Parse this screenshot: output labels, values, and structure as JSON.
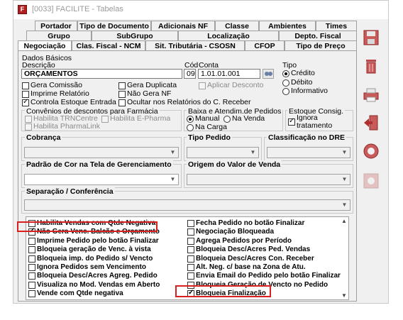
{
  "window": {
    "title": "[0033] FACILITE - Tabelas"
  },
  "tabs": {
    "row1": [
      "Portador",
      "Tipo de Documento",
      "Adicionais NF",
      "Classe",
      "Ambientes",
      "Times"
    ],
    "row2": [
      "Grupo",
      "SubGrupo",
      "Localização",
      "Depto. Fiscal"
    ],
    "row3": [
      "Negociação",
      "Clas. Fiscal - NCM",
      "Sit. Tributária - CSOSN",
      "CFOP",
      "Tipo de Preço"
    ]
  },
  "dados": {
    "section_title": "Dados Básicos",
    "descricao_label": "Descrição",
    "descricao_value": "ORÇAMENTOS",
    "cod_label": "Cód",
    "cod_value": "09",
    "conta_label": "Conta",
    "conta_value": "1.01.01.001",
    "tipo_label": "Tipo",
    "tipo_options": [
      "Crédito",
      "Débito",
      "Informativo"
    ],
    "tipo_selected": "Crédito",
    "checks": {
      "gera_comissao": "Gera Comissão",
      "imprime_relatorio": "Imprime Relatório",
      "controla_estoque": "Controla Estoque Entrada",
      "gera_duplicata": "Gera Duplicata",
      "nao_gera_nf": "Não Gera NF",
      "ocultar_relatorios": "Ocultar nos Relatórios do C. Receber",
      "aplicar_desconto": "Aplicar Desconto"
    }
  },
  "convenios": {
    "title": "Convênios de descontos para Farmácia",
    "trn": "Habilita TRNCentre",
    "epharma": "Habilita E-Pharma",
    "pharmalink": "Habilita PharmaLink"
  },
  "baixa": {
    "title": "Baixa e Atendim.de Pedidos",
    "options": [
      "Manual",
      "Na Venda",
      "Na Carga"
    ],
    "selected": "Manual"
  },
  "estoque": {
    "title": "Estoque Consig.",
    "ignora": "Ignora tratamento"
  },
  "combos": {
    "cobranca": "Cobrança",
    "tipo_pedido": "Tipo Pedido",
    "classificacao_dre": "Classificação no DRE",
    "padrao_cor": "Padrão de Cor na Tela de Gerenciamento",
    "origem_valor": "Origem do Valor de Venda",
    "separacao": "Separação / Conferência"
  },
  "options_left": [
    {
      "label": "Habilita Vendas com Qtde Negativa",
      "checked": false
    },
    {
      "label": "Não Gera Venc. Balcão e Orçamento",
      "checked": true
    },
    {
      "label": "Imprime Pedido pelo botão Finalizar",
      "checked": false
    },
    {
      "label": "Bloqueia geração de Venc. à vista",
      "checked": false
    },
    {
      "label": "Bloqueia imp. do Pedido s/ Vencto",
      "checked": false
    },
    {
      "label": "Ignora Pedidos sem Vencimento",
      "checked": false
    },
    {
      "label": "Bloqueia Desc/Acres Agreg. Pedido",
      "checked": false
    },
    {
      "label": "Visualiza no Mod. Vendas em Aberto",
      "checked": false
    },
    {
      "label": "Vende com Qtde negativa",
      "checked": false
    }
  ],
  "options_right": [
    {
      "label": "Fecha Pedido no botão Finalizar",
      "checked": false
    },
    {
      "label": "Negociação Bloqueada",
      "checked": false
    },
    {
      "label": "Agrega Pedidos por Período",
      "checked": false
    },
    {
      "label": "Bloqueia Desc/Acres Ped. Vendas",
      "checked": false
    },
    {
      "label": "Bloqueia Desc/Acres Con. Receber",
      "checked": false
    },
    {
      "label": "Alt. Neg. c/ base na Zona de Atu.",
      "checked": false
    },
    {
      "label": "Envia Email do Pedido pelo botão Finalizar",
      "checked": false
    },
    {
      "label": "Bloqueia Geração de Vencto no Pedido",
      "checked": false
    },
    {
      "label": "Bloqueia Finalização",
      "checked": true
    }
  ],
  "sidebar": [
    "save-icon",
    "delete-icon",
    "print-icon",
    "exit-icon",
    "help-icon",
    "settings-icon"
  ],
  "colors": {
    "highlight": "#d92020"
  }
}
